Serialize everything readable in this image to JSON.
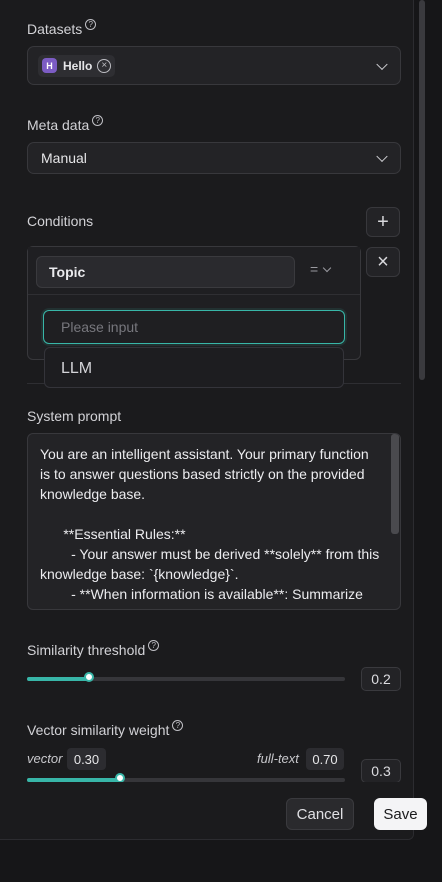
{
  "datasets": {
    "label": "Datasets",
    "help": "?",
    "tag": {
      "avatar": "H",
      "name": "Hello",
      "remove": "×"
    }
  },
  "metadata": {
    "label": "Meta data",
    "help": "?",
    "value": "Manual"
  },
  "conditions": {
    "label": "Conditions",
    "add": "+",
    "remove": "×",
    "field": "Topic",
    "operator": "=",
    "search_placeholder": "Please input",
    "options": [
      "LLM"
    ]
  },
  "system_prompt": {
    "label": "System prompt",
    "text": "You are an intelligent assistant. Your primary function is to answer questions based strictly on the provided knowledge base.\n\n      **Essential Rules:**\n        - Your answer must be derived **solely** from this knowledge base: `{knowledge}`.\n        - **When information is available**: Summarize the content to give a detailed answer."
  },
  "similarity_threshold": {
    "label": "Similarity threshold",
    "help": "?",
    "value": "0.2",
    "fraction": 0.2
  },
  "vector_weight": {
    "label": "Vector similarity weight",
    "help": "?",
    "vector_label": "vector",
    "vector_value": "0.30",
    "fulltext_label": "full-text",
    "fulltext_value": "0.70",
    "value": "0.3",
    "fraction": 0.3
  },
  "footer": {
    "cancel": "Cancel",
    "save": "Save"
  },
  "colors": {
    "accent": "#38b6a8",
    "avatar": "#7c5cc4"
  }
}
